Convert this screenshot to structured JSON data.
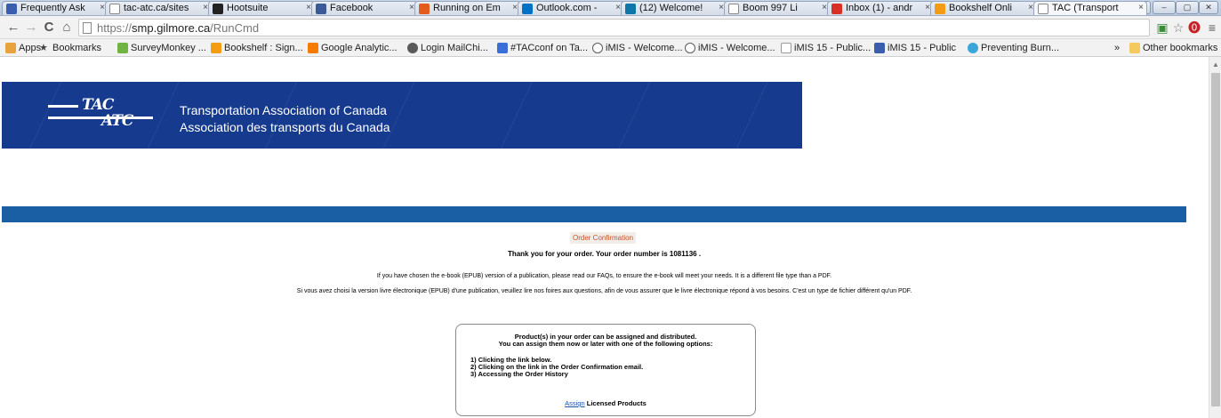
{
  "browser": {
    "tabs": [
      {
        "title": "Frequently Ask",
        "color": "#3a5dae"
      },
      {
        "title": "tac-atc.ca/sites",
        "color": "#ffffff"
      },
      {
        "title": "Hootsuite",
        "color": "#222222"
      },
      {
        "title": "Facebook",
        "color": "#3b5998"
      },
      {
        "title": "Running on Em",
        "color": "#e35b1d"
      },
      {
        "title": "Outlook.com -",
        "color": "#0072c6"
      },
      {
        "title": "(12) Welcome!",
        "color": "#0e76a8"
      },
      {
        "title": "Boom 997 Li",
        "color": "#ffffff"
      },
      {
        "title": "Inbox (1) - andr",
        "color": "#d93025"
      },
      {
        "title": "Bookshelf Onli",
        "color": "#f39c12"
      },
      {
        "title": "TAC (Transport",
        "color": "#ffffff"
      }
    ],
    "url_scheme": "https://",
    "url_host": "smp.gilmore.ca",
    "url_path": "/RunCmd",
    "bookmarks": [
      {
        "label": "Apps",
        "color": "#e8a33d"
      },
      {
        "label": "Bookmarks",
        "color": "#444444"
      },
      {
        "label": "SurveyMonkey ...",
        "color": "#6fb440"
      },
      {
        "label": "Bookshelf : Sign...",
        "color": "#f39c12"
      },
      {
        "label": "Google Analytic...",
        "color": "#f57c00"
      },
      {
        "label": "Login  MailChi...",
        "color": "#5a5a5a"
      },
      {
        "label": "#TACconf on Ta...",
        "color": "#3a6fd8"
      },
      {
        "label": "iMIS - Welcome...",
        "color": "#5a5a5a"
      },
      {
        "label": "iMIS - Welcome...",
        "color": "#5a5a5a"
      },
      {
        "label": "iMIS 15 - Public...",
        "color": "#ffffff"
      },
      {
        "label": "iMIS 15 - Public",
        "color": "#3a5dae"
      },
      {
        "label": "Preventing Burn...",
        "color": "#3ba7d8"
      }
    ],
    "other_bookmarks": "Other bookmarks",
    "chevron": "»"
  },
  "header": {
    "org_en": "Transportation Association of Canada",
    "org_fr": "Association des transports du Canada",
    "logo_top": "TAC",
    "logo_bottom": "ATC",
    "brand_color": "#163b8e",
    "bar_color": "#1a5ea4"
  },
  "content": {
    "section_title": "Order Confirmation",
    "thanks": "Thank you for your order. Your order number is 1081136 .",
    "epub_en": "If you have chosen the e-book (EPUB) version of a publication,  please read our FAQs, to ensure the e-book will meet your needs.  It is a different file type than a PDF.",
    "epub_fr": "Si vous avez choisi la version livre électronique (EPUB) d'une publication, veuillez lire nos foires aux questions, afin de vous assurer que le livre électronique répond à vos besoins. C'est un type de fichier différent qu'un PDF.",
    "box": {
      "line1": "Product(s) in your order can be assigned and distributed.",
      "line2": "You can assign them now or later with one of the following options:",
      "options": [
        "1) Clicking the link below.",
        "2) Clicking on the link in the Order Confirmation email.",
        "3) Accessing the Order History"
      ],
      "assign_link": "Assign",
      "assign_rest": " Licensed Products"
    }
  }
}
